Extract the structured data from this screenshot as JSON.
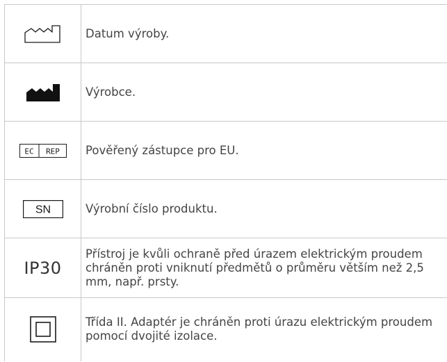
{
  "rows": [
    {
      "icon": "date-of-manufacture-icon",
      "description": "Datum výroby."
    },
    {
      "icon": "manufacturer-icon",
      "description": "Výrobce."
    },
    {
      "icon": "ec-rep-icon",
      "icon_text_left": "EC",
      "icon_text_right": "REP",
      "description": "Pověřený zástupce pro EU."
    },
    {
      "icon": "serial-number-icon",
      "icon_text": "SN",
      "description": "Výrobní číslo produktu."
    },
    {
      "icon": "ip-rating-icon",
      "icon_text": "IP30",
      "description": "Přístroj je kvůli ochraně před úrazem elektrickým proudem chráněn proti vniknutí předmětů o průměru větším než 2,5 mm, např. prsty."
    },
    {
      "icon": "class-ii-icon",
      "description": "Třída II. Adaptér je chráněn proti úrazu elektrickým proudem pomocí dvojité izolace."
    }
  ]
}
